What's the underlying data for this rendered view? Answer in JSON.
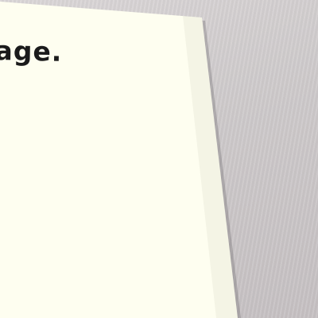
{
  "scene": {
    "paper_text": "age.",
    "paper_color": "#fefef0",
    "surface_color": "#d3cfd0"
  }
}
